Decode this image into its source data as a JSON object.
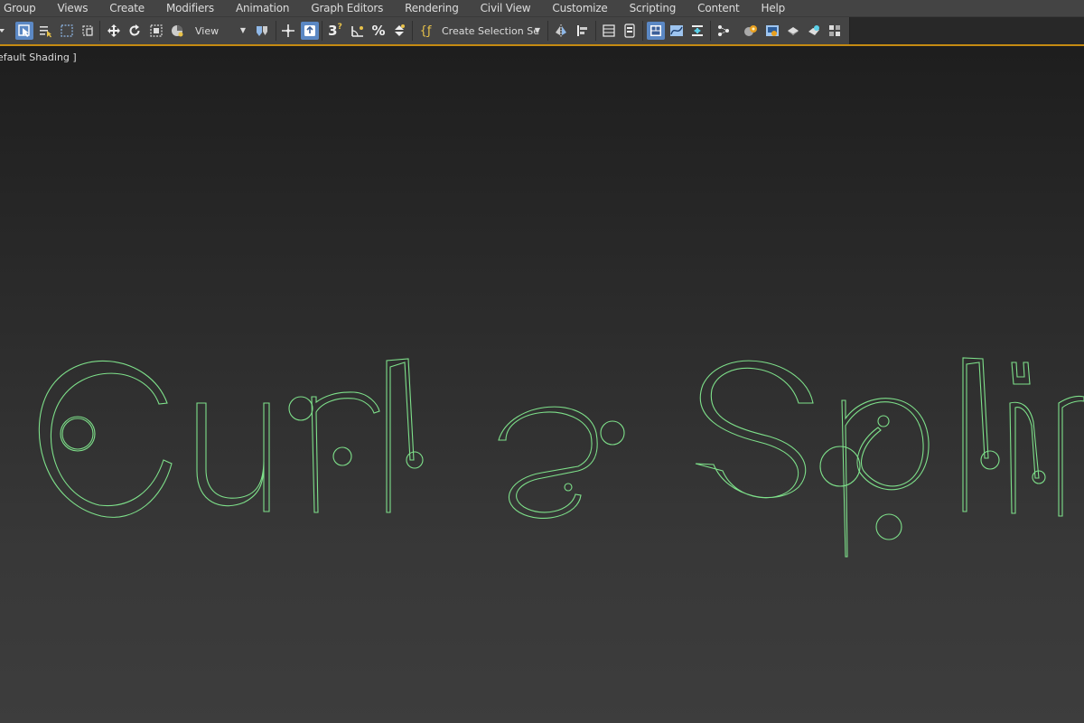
{
  "menubar": {
    "items": [
      "Group",
      "Views",
      "Create",
      "Modifiers",
      "Animation",
      "Graph Editors",
      "Rendering",
      "Civil View",
      "Customize",
      "Scripting",
      "Content",
      "Help"
    ]
  },
  "toolbar": {
    "reference_coord_value": "View",
    "named_selection_value": "Create Selection Se",
    "snaps_label": "3",
    "icons": [
      "select-object-icon",
      "select-by-name-icon",
      "rectangular-selection-icon",
      "window-crossing-icon",
      "select-move-icon",
      "select-rotate-icon",
      "select-scale-icon",
      "select-place-icon",
      "use-pivot-icon",
      "select-manipulate-icon",
      "snaps-toggle-icon",
      "angle-snap-icon",
      "percent-snap-icon",
      "spinner-snap-icon",
      "edit-named-selection-icon",
      "mirror-icon",
      "align-icon",
      "layer-explorer-icon",
      "scene-explorer-icon",
      "graphite-ribbon-icon",
      "curve-editor-icon",
      "dope-sheet-icon",
      "schematic-view-icon",
      "material-editor-icon",
      "render-setup-icon",
      "rendered-frame-icon",
      "render-production-icon",
      "render-iterative-icon"
    ],
    "accent_line_color": "#c58b12",
    "active_color": "#5b88c4"
  },
  "viewport": {
    "label": "efault Shading ]",
    "spline_text": "Curl a Splin",
    "spline_color": "#7ee08a"
  }
}
